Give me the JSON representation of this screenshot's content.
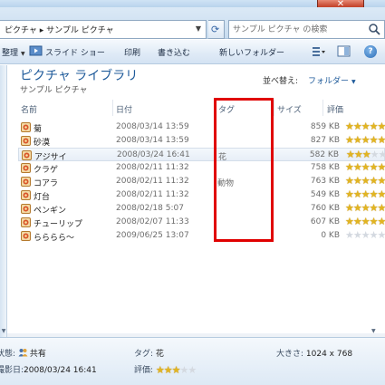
{
  "window": {
    "close_glyph": "✕"
  },
  "address": {
    "path_text": "ピクチャ ▸ サンプル ピクチャ",
    "search_placeholder": "サンプル ピクチャ の検索"
  },
  "toolbar": {
    "items": [
      "整理",
      "スライド ショー",
      "印刷",
      "書き込む",
      "新しいフォルダー"
    ],
    "help_glyph": "?"
  },
  "library": {
    "title": "ピクチャ ライブラリ",
    "subtitle": "サンプル ピクチャ",
    "arrange_label": "並べ替え:",
    "arrange_value": "フォルダー"
  },
  "columns": {
    "name": "名前",
    "date": "日付",
    "tag": "タグ",
    "size": "サイズ",
    "rating": "評価"
  },
  "files": [
    {
      "name": "菊",
      "date": "2008/03/14 13:59",
      "tag": "",
      "size": "859 KB",
      "rating": 5
    },
    {
      "name": "砂漠",
      "date": "2008/03/14 13:59",
      "tag": "",
      "size": "827 KB",
      "rating": 5
    },
    {
      "name": "アジサイ",
      "date": "2008/03/24 16:41",
      "tag": "花",
      "size": "582 KB",
      "rating": 3
    },
    {
      "name": "クラゲ",
      "date": "2008/02/11 11:32",
      "tag": "",
      "size": "758 KB",
      "rating": 5
    },
    {
      "name": "コアラ",
      "date": "2008/02/11 11:32",
      "tag": "動物",
      "size": "763 KB",
      "rating": 5
    },
    {
      "name": "灯台",
      "date": "2008/02/11 11:32",
      "tag": "",
      "size": "549 KB",
      "rating": 5
    },
    {
      "name": "ペンギン",
      "date": "2008/02/18 5:07",
      "tag": "",
      "size": "760 KB",
      "rating": 5
    },
    {
      "name": "チューリップ",
      "date": "2008/02/07 11:33",
      "tag": "",
      "size": "607 KB",
      "rating": 5
    },
    {
      "name": "らららら～",
      "date": "2009/06/25 13:07",
      "tag": "",
      "size": "0 KB",
      "rating": 0
    }
  ],
  "details": {
    "state_label": "状態:",
    "state_value": "共有",
    "taken_label": "撮影日:",
    "taken_value": "2008/03/24 16:41",
    "tag_label": "タグ:",
    "tag_value": "花",
    "rating_label": "評価:",
    "rating_value": 3,
    "size_label": "大きさ:",
    "size_value": "1024 x 768"
  },
  "colors": {
    "highlight": "#e00000",
    "star_on": "#e2b521",
    "star_off": "#d4d9e0",
    "title_blue": "#1e5a9a"
  },
  "icons": {
    "file": "image-file-icon",
    "search": "search-icon",
    "refresh": "refresh-icon",
    "slideshow": "slideshow-icon",
    "pane": "preview-pane-icon",
    "help": "help-icon",
    "share": "shared-users-icon"
  }
}
